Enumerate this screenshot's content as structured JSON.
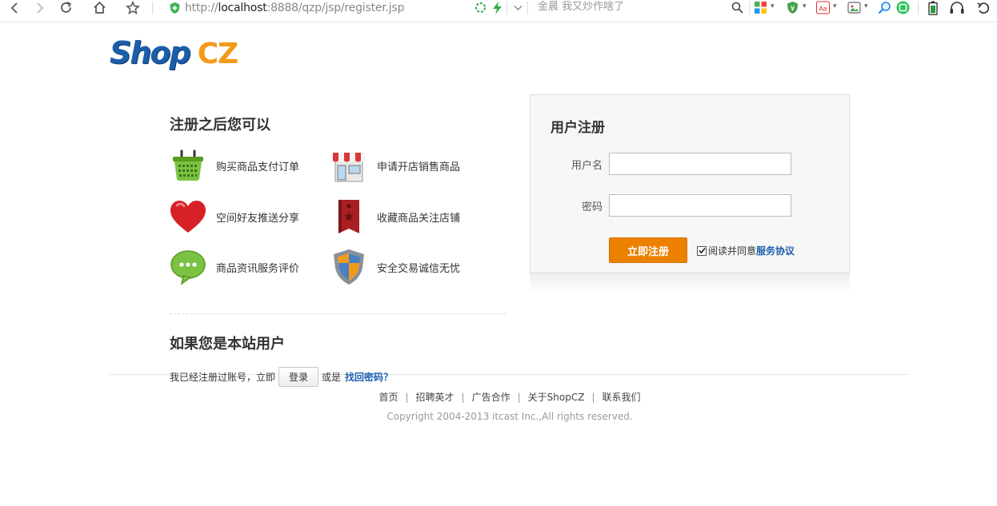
{
  "browser": {
    "url_prefix": "http://",
    "url_host": "localhost",
    "url_rest": ":8888/qzp/jsp/register.jsp",
    "search_placeholder": "金晨 我又炒作啥了"
  },
  "logo": {
    "shop": "Shop",
    "cz": "CZ"
  },
  "intro": {
    "title": "注册之后您可以",
    "features": [
      {
        "label": "购买商品支付订单",
        "icon": "basket-icon"
      },
      {
        "label": "申请开店销售商品",
        "icon": "store-icon"
      },
      {
        "label": "空间好友推送分享",
        "icon": "heart-icon"
      },
      {
        "label": "收藏商品关注店铺",
        "icon": "bookmark-icon"
      },
      {
        "label": "商品资讯服务评价",
        "icon": "chat-bubble-icon"
      },
      {
        "label": "安全交易诚信无忧",
        "icon": "shield-icon"
      }
    ]
  },
  "existing_user": {
    "title": "如果您是本站用户",
    "prefix": "我已经注册过账号，立即",
    "login_button": "登录",
    "or": "或是",
    "forgot_link": "找回密码？"
  },
  "register": {
    "title": "用户注册",
    "username_label": "用户名",
    "username_value": "",
    "password_label": "密码",
    "password_value": "",
    "submit_button": "立即注册",
    "agree_text": "阅读并同意",
    "agree_link": "服务协议",
    "agree_checked": true
  },
  "footer": {
    "links": [
      "首页",
      "招聘英才",
      "广告合作",
      "关于ShopCZ",
      "联系我们"
    ],
    "separator": "|",
    "copyright": "Copyright 2004-2013 itcast Inc.,All rights reserved."
  },
  "colors": {
    "accent_orange": "#ec8100",
    "link_blue": "#1d5fae",
    "logo_blue": "#1c5ea8",
    "logo_orange": "#f39a1a"
  }
}
